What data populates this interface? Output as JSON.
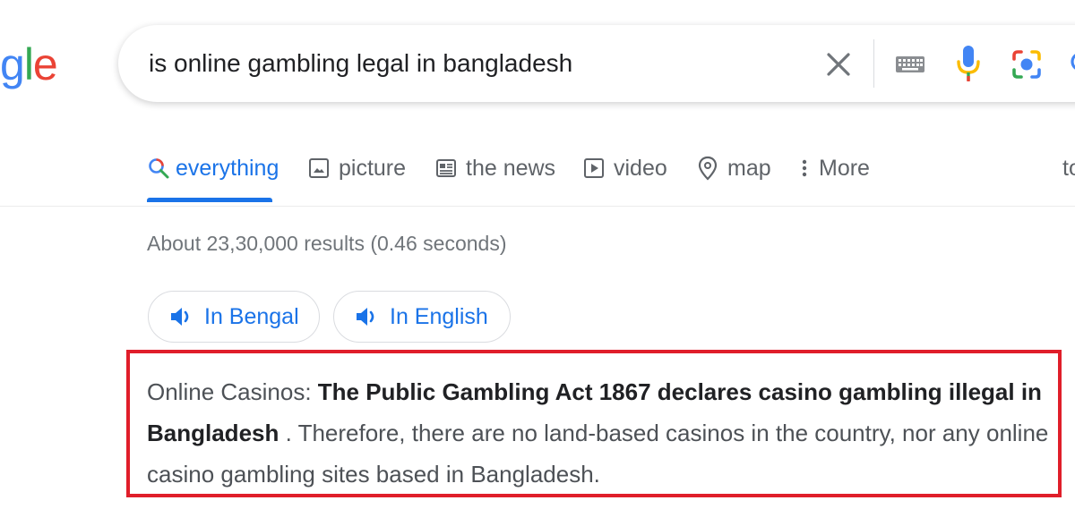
{
  "logo": {
    "part_g": "g",
    "part_l": "l",
    "part_e": "e"
  },
  "search": {
    "query": "is online gambling legal in bangladesh",
    "icons": [
      "close-icon",
      "keyboard-icon",
      "microphone-icon",
      "camera-lens-icon",
      "search-icon"
    ]
  },
  "tabs": [
    {
      "label": "everything",
      "icon": "search-icon",
      "active": true
    },
    {
      "label": "picture",
      "icon": "image-icon",
      "active": false
    },
    {
      "label": "the news",
      "icon": "newspaper-icon",
      "active": false
    },
    {
      "label": "video",
      "icon": "play-icon",
      "active": false
    },
    {
      "label": "map",
      "icon": "map-pin-icon",
      "active": false
    },
    {
      "label": "More",
      "icon": "more-vert-icon",
      "active": false
    },
    {
      "label": "to",
      "icon": "",
      "active": false
    }
  ],
  "results_stats": "About 23,30,000 results (0.46 seconds)",
  "chips": [
    {
      "label": "In Bengal",
      "icon": "speaker-icon"
    },
    {
      "label": "In English",
      "icon": "speaker-icon"
    }
  ],
  "snippet": {
    "prefix": "Online Casinos: ",
    "bold": "The Public Gambling Act 1867 declares casino gambling illegal in Bangladesh",
    "rest": " . Therefore, there are no land-based casinos in the country, nor any online casino gambling sites based in Bangladesh."
  },
  "colors": {
    "accent": "#1a73e8",
    "highlight_border": "#e01e2a",
    "google_blue": "#4285f4",
    "google_red": "#ea4335",
    "google_yellow": "#fbbc04",
    "google_green": "#34a853"
  }
}
